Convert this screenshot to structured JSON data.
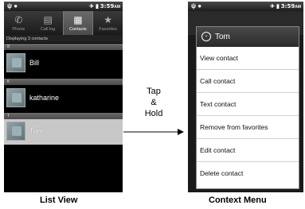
{
  "left": {
    "status": {
      "time": "3:59",
      "ampm": "AM"
    },
    "tabs": [
      {
        "label": "Phone",
        "icon": "phone-icon"
      },
      {
        "label": "Call log",
        "icon": "call-log-icon"
      },
      {
        "label": "Contacts",
        "icon": "contacts-icon",
        "active": true
      },
      {
        "label": "Favorites",
        "icon": "star-icon"
      }
    ],
    "displaying": "Displaying 3 contacts",
    "sections": [
      {
        "letter": "B",
        "contact": "Bill"
      },
      {
        "letter": "K",
        "contact": "katharine"
      },
      {
        "letter": "T",
        "contact": "Tom"
      }
    ]
  },
  "right": {
    "status": {
      "time": "3:59",
      "ampm": "AM"
    },
    "menu": {
      "title": "Tom",
      "items": [
        "View contact",
        "Call contact",
        "Text contact",
        "Remove from favorites",
        "Edit contact",
        "Delete contact"
      ]
    }
  },
  "annotation": {
    "line1": "Tap",
    "line2": "&",
    "line3": "Hold"
  },
  "captions": {
    "left": "List View",
    "right": "Context Menu"
  }
}
